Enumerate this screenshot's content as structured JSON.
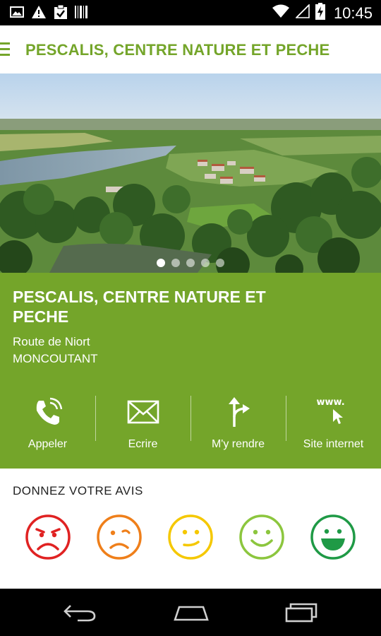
{
  "status_bar": {
    "time": "10:45",
    "icons": [
      "image-icon",
      "warning-icon",
      "clipboard-check-icon",
      "barcode-icon",
      "wifi-icon",
      "signal-icon",
      "battery-charging-icon"
    ]
  },
  "app_bar": {
    "title": "PESCALIS, CENTRE NATURE ET PECHE",
    "accent_color": "#74a52a"
  },
  "hero": {
    "slide_count": 5,
    "active_slide": 1
  },
  "place": {
    "name": "PESCALIS, CENTRE NATURE ET PECHE",
    "address_line1": "Route de Niort",
    "address_line2": "MONCOUTANT",
    "background_color": "#74a52a"
  },
  "actions": [
    {
      "label": "Appeler",
      "icon": "phone-icon"
    },
    {
      "label": "Ecrire",
      "icon": "envelope-icon"
    },
    {
      "label": "M'y rendre",
      "icon": "directions-icon"
    },
    {
      "label": "Site internet",
      "icon": "web-cursor-icon",
      "icon_text": "www."
    }
  ],
  "feedback": {
    "title": "DONNEZ VOTRE AVIS",
    "ratings": [
      {
        "name": "very-sad",
        "color": "#e02222"
      },
      {
        "name": "sad",
        "color": "#ef7f1a"
      },
      {
        "name": "neutral",
        "color": "#f5c800"
      },
      {
        "name": "happy",
        "color": "#8cc63e"
      },
      {
        "name": "very-happy",
        "color": "#1f9a46"
      }
    ]
  },
  "nav_bar": {
    "buttons": [
      "back-icon",
      "home-icon",
      "recents-icon"
    ]
  }
}
